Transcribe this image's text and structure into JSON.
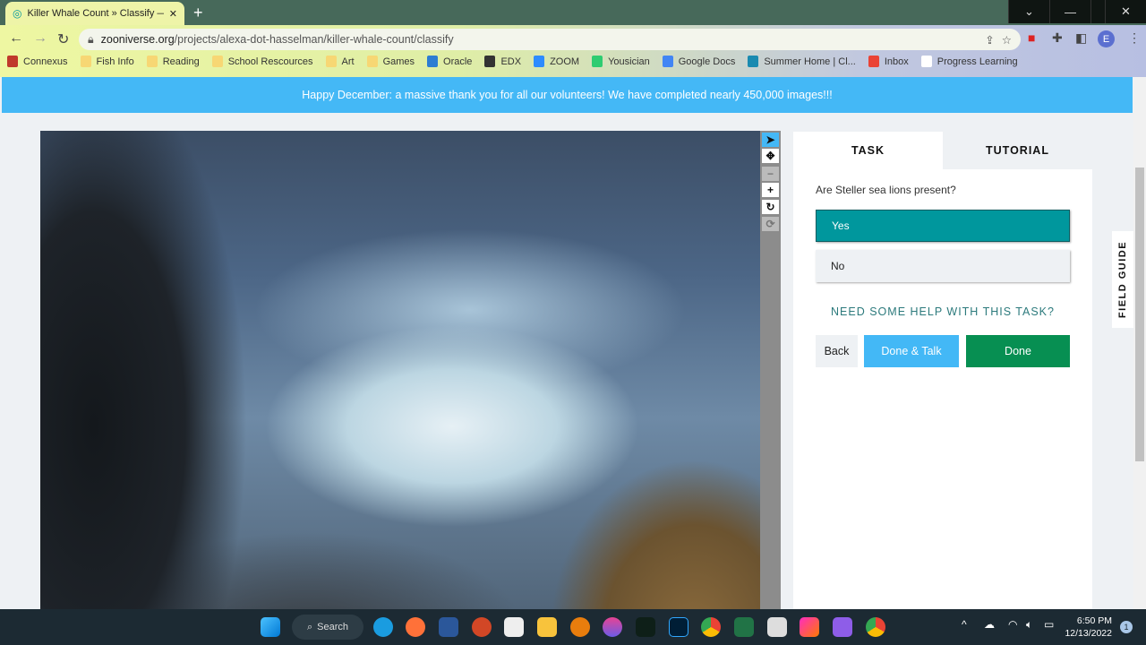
{
  "browser": {
    "tab_title": "Killer Whale Count » Classify — Zooniverse",
    "url_domain": "zooniverse.org",
    "url_path": "/projects/alexa-dot-hasselman/killer-whale-count/classify",
    "profile_initial": "E"
  },
  "bookmarks": [
    {
      "label": "Connexus",
      "color": "#c0392b"
    },
    {
      "label": "Fish Info",
      "color": "#f7d774"
    },
    {
      "label": "Reading",
      "color": "#f7d774"
    },
    {
      "label": "School Rescources",
      "color": "#f7d774"
    },
    {
      "label": "Art",
      "color": "#f7d774"
    },
    {
      "label": "Games",
      "color": "#f7d774"
    },
    {
      "label": "Oracle",
      "color": "#2d7dd2"
    },
    {
      "label": "EDX",
      "color": "#333333"
    },
    {
      "label": "ZOOM",
      "color": "#2d8cff"
    },
    {
      "label": "Yousician",
      "color": "#2ecc71"
    },
    {
      "label": "Google Docs",
      "color": "#4285f4"
    },
    {
      "label": "Summer Home | Cl...",
      "color": "#1a8ab0"
    },
    {
      "label": "Inbox",
      "color": "#ea4335"
    },
    {
      "label": "Progress Learning",
      "color": "#ffffff"
    }
  ],
  "banner": {
    "text": "Happy December: a massive thank you for all our volunteers! We have completed nearly 450,000 images!!!"
  },
  "panel": {
    "tabs": [
      "TASK",
      "TUTORIAL"
    ],
    "question": "Are Steller sea lions present?",
    "answers": [
      "Yes",
      "No"
    ],
    "help": "NEED SOME HELP WITH THIS TASK?",
    "back": "Back",
    "done_talk": "Done & Talk",
    "done": "Done"
  },
  "field_guide": "FIELD GUIDE",
  "taskbar": {
    "search": "Search",
    "time": "6:50 PM",
    "date": "12/13/2022",
    "notifications": "1"
  },
  "colors": {
    "banner": "#44b8f6",
    "selected": "#00979d",
    "done": "#078f52",
    "done_talk": "#43b8f6"
  }
}
